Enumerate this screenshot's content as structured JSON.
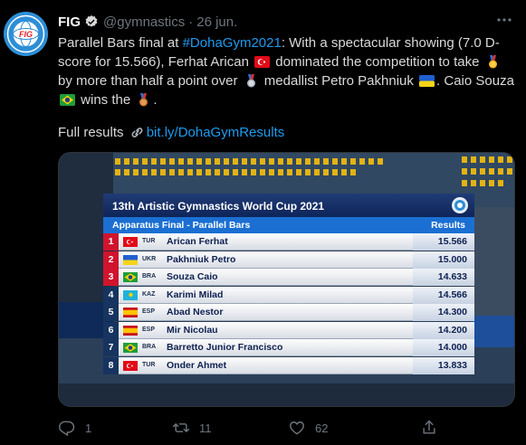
{
  "tweet": {
    "author_name": "FIG",
    "handle": "@gymnastics",
    "separator": "·",
    "date": "26 jun.",
    "text": {
      "p1": "Parallel Bars final at ",
      "hashtag": "#DohaGym2021",
      "p2": ": With a spectacular showing (7.0 D-score for 15.566), Ferhat Arican ",
      "p3": " dominated the competition to take ",
      "p4": " by more than half a point over ",
      "p5": " medallist Petro Pakhniuk ",
      "p6": ". Caio Souza ",
      "p7": " wins the ",
      "p8": "."
    },
    "results_label": "Full results ",
    "results_link": "bit.ly/DohaGymResults",
    "actions": {
      "replies": "1",
      "retweets": "11",
      "likes": "62"
    },
    "icons": {
      "verified": "verified-badge-icon",
      "more": "more-icon",
      "reply": "reply-icon",
      "retweet": "retweet-icon",
      "like": "heart-icon",
      "share": "share-icon",
      "link": "link-icon"
    },
    "colors": {
      "link": "#1d9bf0",
      "muted": "#6e767d",
      "text": "#d9d9d9",
      "background": "#000000"
    }
  },
  "scoreboard": {
    "title": "13th Artistic Gymnastics World Cup 2021",
    "subtitle": "Apparatus Final - Parallel Bars",
    "results_header": "Results",
    "rows": [
      {
        "rank": "1",
        "nat": "TUR",
        "name": "Arican Ferhat",
        "score": "15.566",
        "rank_color": "#d0142d",
        "flag": "tur"
      },
      {
        "rank": "2",
        "nat": "UKR",
        "name": "Pakhniuk Petro",
        "score": "15.000",
        "rank_color": "#d0142d",
        "flag": "ukr"
      },
      {
        "rank": "3",
        "nat": "BRA",
        "name": "Souza Caio",
        "score": "14.633",
        "rank_color": "#d0142d",
        "flag": "bra"
      },
      {
        "rank": "4",
        "nat": "KAZ",
        "name": "Karimi Milad",
        "score": "14.566",
        "rank_color": "#16345f",
        "flag": "kaz"
      },
      {
        "rank": "5",
        "nat": "ESP",
        "name": "Abad Nestor",
        "score": "14.300",
        "rank_color": "#16345f",
        "flag": "esp"
      },
      {
        "rank": "6",
        "nat": "ESP",
        "name": "Mir Nicolau",
        "score": "14.200",
        "rank_color": "#16345f",
        "flag": "esp"
      },
      {
        "rank": "7",
        "nat": "BRA",
        "name": "Barretto Junior Francisco",
        "score": "14.000",
        "rank_color": "#16345f",
        "flag": "bra"
      },
      {
        "rank": "8",
        "nat": "TUR",
        "name": "Onder Ahmet",
        "score": "13.833",
        "rank_color": "#16345f",
        "flag": "tur"
      }
    ]
  }
}
